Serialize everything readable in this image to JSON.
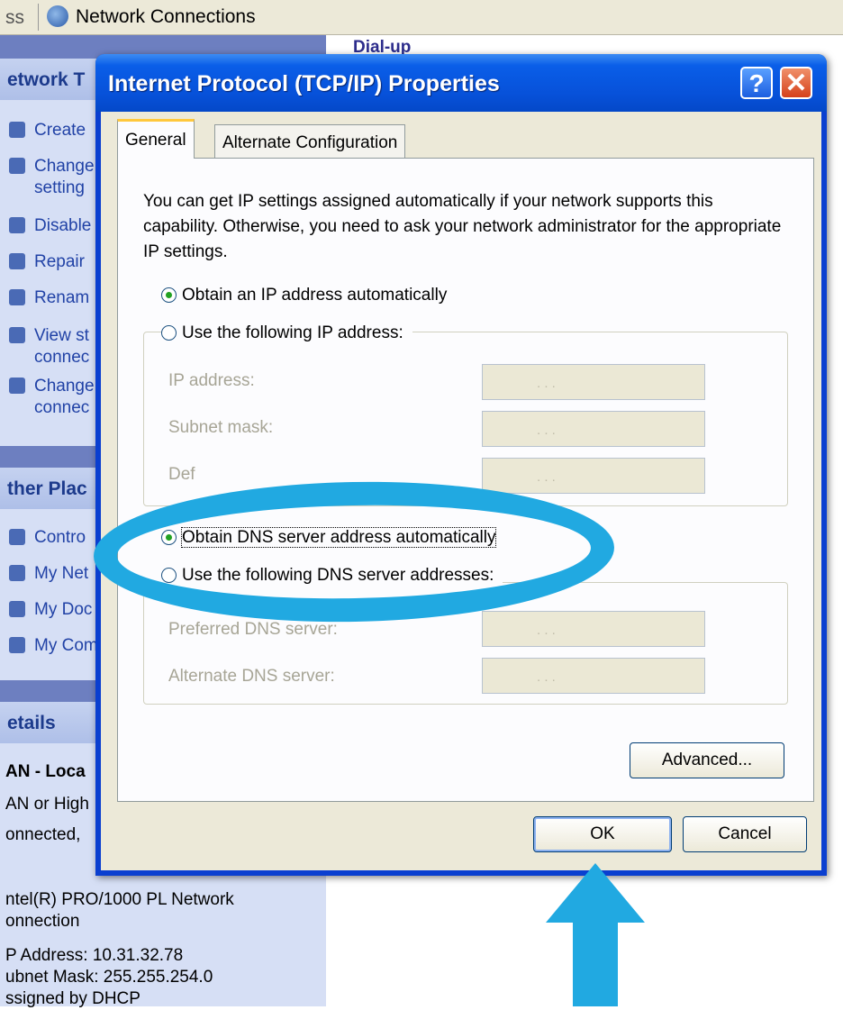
{
  "background": {
    "address_fragment": "ss",
    "window_title": "Network Connections",
    "dialup_heading": "Dial-up",
    "network_tasks_heading": "etwork T",
    "network_tasks": [
      "Create",
      "Change",
      "setting",
      "Disable",
      "Repair",
      "Renam",
      "View st",
      "connec",
      "Change",
      "connec"
    ],
    "other_places_heading": "ther Plac",
    "other_places": [
      "Contro",
      "My Net",
      "My Doc",
      "My Com"
    ],
    "details_heading": "etails",
    "details_lines": [
      "AN - Loca",
      "AN or High",
      "onnected,",
      "ntel(R) PRO/1000 PL Network",
      "onnection",
      "P Address: 10.31.32.78",
      "ubnet Mask: 255.255.254.0",
      "ssigned by DHCP"
    ]
  },
  "dialog": {
    "title": "Internet Protocol (TCP/IP) Properties",
    "help_label": "?",
    "close_label": "✕",
    "tabs": [
      {
        "label": "General",
        "active": true
      },
      {
        "label": "Alternate Configuration",
        "active": false
      }
    ],
    "description": "You can get IP settings assigned automatically if your network supports this capability. Otherwise, you need to ask your network administrator for the appropriate IP settings.",
    "ip_radio_auto": {
      "label": "Obtain an IP address automatically",
      "selected": true
    },
    "ip_radio_manual": {
      "label": "Use the following IP address:",
      "selected": false
    },
    "ip_fields": [
      {
        "label": "IP address:",
        "value": ". . ."
      },
      {
        "label": "Subnet mask:",
        "value": ". . ."
      },
      {
        "label": "Def",
        "value": ". . ."
      }
    ],
    "dns_radio_auto": {
      "label": "Obtain DNS server address automatically",
      "selected": true
    },
    "dns_radio_manual": {
      "label": "Use the following DNS server addresses:",
      "selected": false
    },
    "dns_fields": [
      {
        "label": "Preferred DNS server:",
        "value": ". . ."
      },
      {
        "label": "Alternate DNS server:",
        "value": ". . ."
      }
    ],
    "advanced_label": "Advanced...",
    "ok_label": "OK",
    "cancel_label": "Cancel"
  },
  "colors": {
    "highlight": "#21a9e1",
    "titlebar": "#0751d9",
    "dialog_face": "#ece9d8"
  }
}
